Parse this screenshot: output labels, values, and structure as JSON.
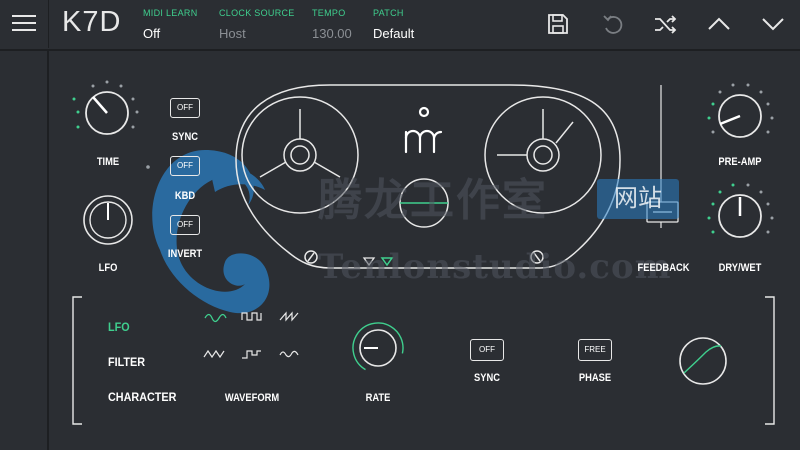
{
  "app": {
    "title": "K7D"
  },
  "header": {
    "midi_learn": {
      "label": "MIDI LEARN",
      "value": "Off"
    },
    "clock_source": {
      "label": "CLOCK SOURCE",
      "value": "Host"
    },
    "tempo": {
      "label": "TEMPO",
      "value": "130.00"
    },
    "patch": {
      "label": "PATCH",
      "value": "Default"
    }
  },
  "toolbar": {
    "icons": [
      "menu-icon",
      "save-icon",
      "undo-icon",
      "shuffle-icon",
      "chevron-up-icon",
      "chevron-down-icon"
    ]
  },
  "delay": {
    "time_label": "TIME",
    "lfo_label": "LFO",
    "sync": {
      "label": "SYNC",
      "state": "OFF"
    },
    "kbd": {
      "label": "KBD",
      "state": "OFF"
    },
    "invert": {
      "label": "INVERT",
      "state": "OFF"
    },
    "feedback_label": "FEEDBACK",
    "preamp_label": "PRE-AMP",
    "drywet_label": "DRY/WET"
  },
  "modulation": {
    "tabs": [
      "LFO",
      "FILTER",
      "CHARACTER"
    ],
    "active_tab": "LFO",
    "waveform_label": "WAVEFORM",
    "rate_label": "RATE",
    "sync": {
      "label": "SYNC",
      "state": "OFF"
    },
    "phase": {
      "label": "PHASE",
      "state": "FREE"
    }
  },
  "watermark": {
    "chinese": "腾龙工作室",
    "badge": "网站",
    "url": "Tenlonstudio.com"
  },
  "colors": {
    "accent": "#3fcf8e",
    "background": "#2b2e33",
    "line": "#e8e8e8",
    "watermark_blue": "#2a7fc4"
  }
}
